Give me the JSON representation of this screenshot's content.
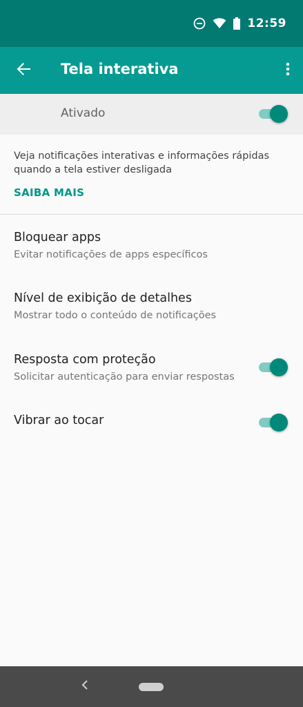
{
  "status_bar": {
    "time": "12:59",
    "icons": [
      "do-not-disturb-icon",
      "wifi-icon",
      "battery-icon"
    ]
  },
  "app_bar": {
    "title": "Tela interativa",
    "back_icon": "arrow-back-icon",
    "overflow_icon": "more-vert-icon"
  },
  "master_switch": {
    "label": "Ativado",
    "checked": true
  },
  "description": {
    "text": "Veja notificações interativas e informações rápidas quando a tela estiver desligada",
    "link": "SAIBA MAIS"
  },
  "preferences": [
    {
      "title": "Bloquear apps",
      "summary": "Evitar notificações de apps específicos"
    },
    {
      "title": "Nível de exibição de detalhes",
      "summary": "Mostrar todo o conteúdo de notificações"
    },
    {
      "title": "Resposta com proteção",
      "summary": "Solicitar autenticação para enviar respostas",
      "checked": true
    },
    {
      "title": "Vibrar ao tocar",
      "checked": true
    }
  ],
  "colors": {
    "status_bar": "#027a72",
    "app_bar": "#069b92",
    "accent": "#009688",
    "switch_thumb": "#00897b",
    "switch_track": "#80cbc4"
  }
}
